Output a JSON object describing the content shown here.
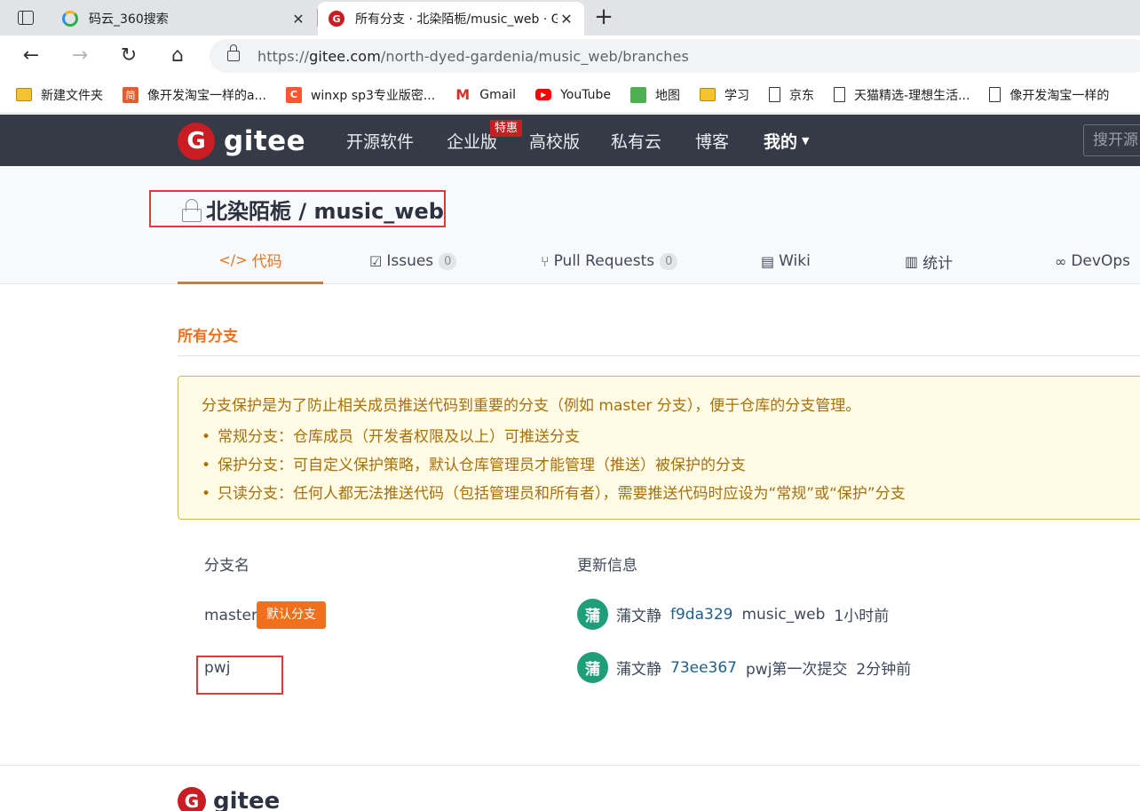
{
  "browser": {
    "tabs": [
      {
        "title": "码云_360搜索",
        "icon": "search-360-icon"
      },
      {
        "title": "所有分支 · 北染陌栀/music_web · Gitee.com",
        "icon": "gitee-icon"
      }
    ],
    "url": {
      "scheme": "https://",
      "host": "gitee.com",
      "path": "/north-dyed-gardenia/music_web/branches"
    },
    "bookmarks": [
      {
        "label": "新建文件夹",
        "icon": "folder-icon"
      },
      {
        "label": "像开发淘宝一样的a...",
        "icon": "jianshu-icon",
        "glyph": "简"
      },
      {
        "label": "winxp sp3专业版密...",
        "icon": "csdn-icon",
        "glyph": "C"
      },
      {
        "label": "Gmail",
        "icon": "gmail-icon",
        "glyph": "M"
      },
      {
        "label": "YouTube",
        "icon": "youtube-icon",
        "glyph": "▶"
      },
      {
        "label": "地图",
        "icon": "maps-icon"
      },
      {
        "label": "学习",
        "icon": "folder-icon"
      },
      {
        "label": "京东",
        "icon": "page-icon"
      },
      {
        "label": "天猫精选-理想生活...",
        "icon": "page-icon"
      },
      {
        "label": "像开发淘宝一样的",
        "icon": "page-icon"
      }
    ]
  },
  "gitee": {
    "logo_text": "gitee",
    "logo_glyph": "G",
    "nav": [
      "开源软件",
      "企业版",
      "高校版",
      "私有云",
      "博客",
      "我的"
    ],
    "hot_badge": "特惠",
    "search_placeholder": "搜开源"
  },
  "repo": {
    "title": "北染陌栀 / music_web",
    "tabs": {
      "code": "代码",
      "issues": "Issues",
      "issues_count": "0",
      "pull_requests": "Pull Requests",
      "pull_requests_count": "0",
      "wiki": "Wiki",
      "stats": "统计",
      "devops": "DevOps"
    }
  },
  "branches": {
    "section_title": "所有分支",
    "notice": {
      "lead": "分支保护是为了防止相关成员推送代码到重要的分支（例如 master 分支），便于仓库的分支管理。",
      "items": [
        "常规分支：仓库成员（开发者权限及以上）可推送分支",
        "保护分支：可自定义保护策略，默认仓库管理员才能管理（推送）被保护的分支",
        "只读分支：任何人都无法推送代码（包括管理员和所有者），需要推送代码时应设为“常规”或“保护”分支"
      ]
    },
    "columns": {
      "name": "分支名",
      "update": "更新信息"
    },
    "default_tag": "默认分支",
    "rows": [
      {
        "name": "master",
        "avatar": "蒲",
        "author": "蒲文静",
        "sha": "f9da329",
        "message": "music_web",
        "time": "1小时前"
      },
      {
        "name": "pwj",
        "avatar": "蒲",
        "author": "蒲文静",
        "sha": "73ee367",
        "message": "pwj第一次提交",
        "time": "2分钟前"
      }
    ]
  },
  "footer": {
    "logo_text": "gitee",
    "logo_glyph": "G"
  },
  "colors": {
    "accent": "#f0701d",
    "brand_red": "#c71d23",
    "header_bg": "#343a46",
    "highlight_box": "#e03a3a",
    "notice_bg": "#fffbe5"
  }
}
